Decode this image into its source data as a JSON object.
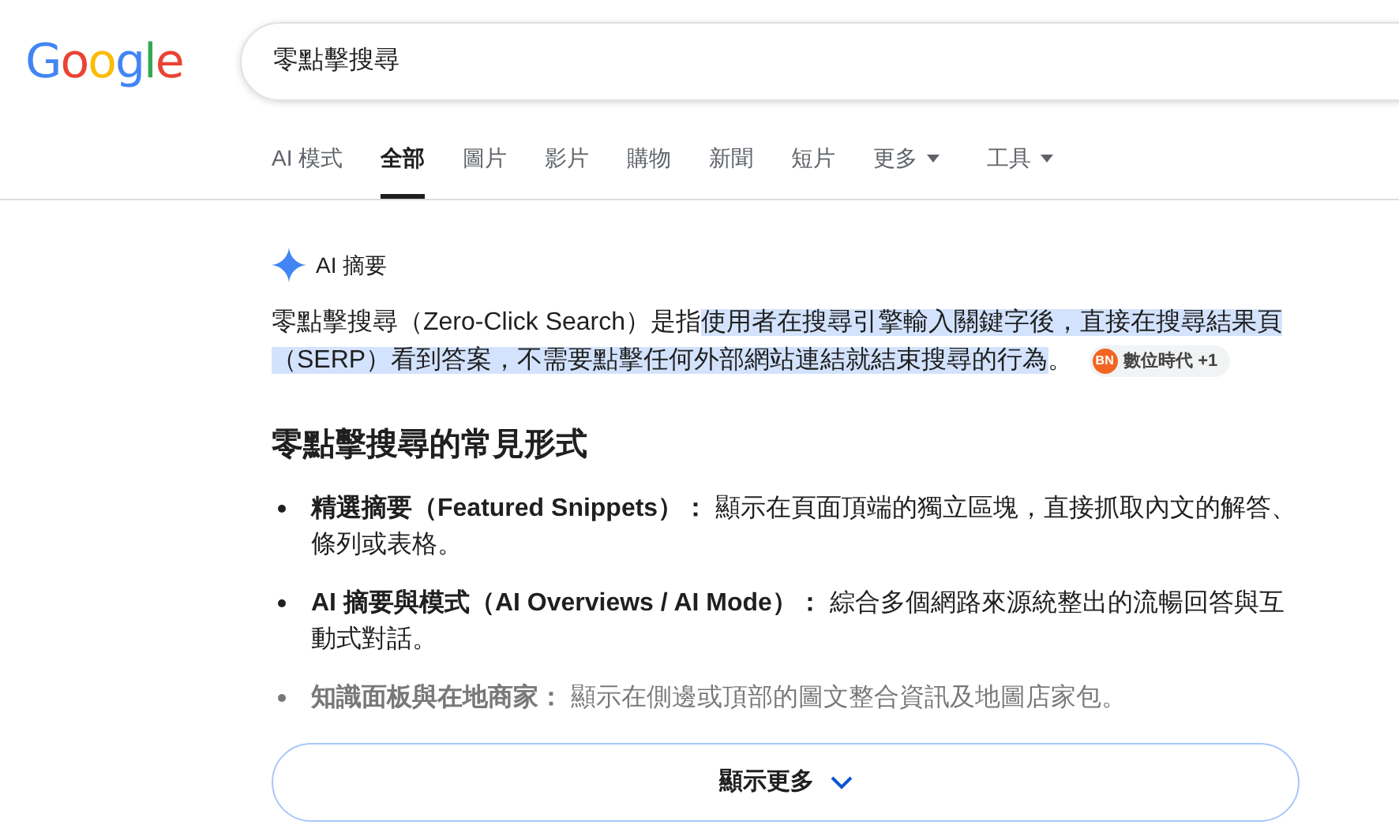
{
  "logo": "Google",
  "search": {
    "value": "零點擊搜尋"
  },
  "tabs": [
    {
      "label": "AI 模式",
      "selected": false,
      "dropdown": false
    },
    {
      "label": "全部",
      "selected": true,
      "dropdown": false
    },
    {
      "label": "圖片",
      "selected": false,
      "dropdown": false
    },
    {
      "label": "影片",
      "selected": false,
      "dropdown": false
    },
    {
      "label": "購物",
      "selected": false,
      "dropdown": false
    },
    {
      "label": "新聞",
      "selected": false,
      "dropdown": false
    },
    {
      "label": "短片",
      "selected": false,
      "dropdown": false
    },
    {
      "label": "更多",
      "selected": false,
      "dropdown": true
    },
    {
      "label": "工具",
      "selected": false,
      "dropdown": true
    }
  ],
  "ai_overview": {
    "label": "AI 摘要",
    "intro": [
      {
        "text": "零點擊搜尋（Zero-Click Search）是指",
        "highlighted": false
      },
      {
        "text": "使用者在搜尋引擎輸入關鍵字後，直接在搜尋結果頁（SERP）看到答案，不需要點擊任何外部網站連結就結束搜尋的行為",
        "highlighted": true
      },
      {
        "text": "。",
        "highlighted": false
      }
    ],
    "source_chip": {
      "logo": "BN",
      "label": "數位時代 +1"
    },
    "heading": "零點擊搜尋的常見形式",
    "bullets": [
      {
        "term": "精選摘要（Featured Snippets）：",
        "text": "顯示在頁面頂端的獨立區塊，直接抓取內文的解答、條列或表格。",
        "faded": false
      },
      {
        "term": "AI 摘要與模式（AI Overviews / AI Mode）：",
        "text": "綜合多個網路來源統整出的流暢回答與互動式對話。",
        "faded": false
      },
      {
        "term": "知識面板與在地商家：",
        "text": "顯示在側邊或頂部的圖文整合資訊及地圖店家包。",
        "faded": true
      }
    ],
    "show_more": "顯示更多"
  }
}
